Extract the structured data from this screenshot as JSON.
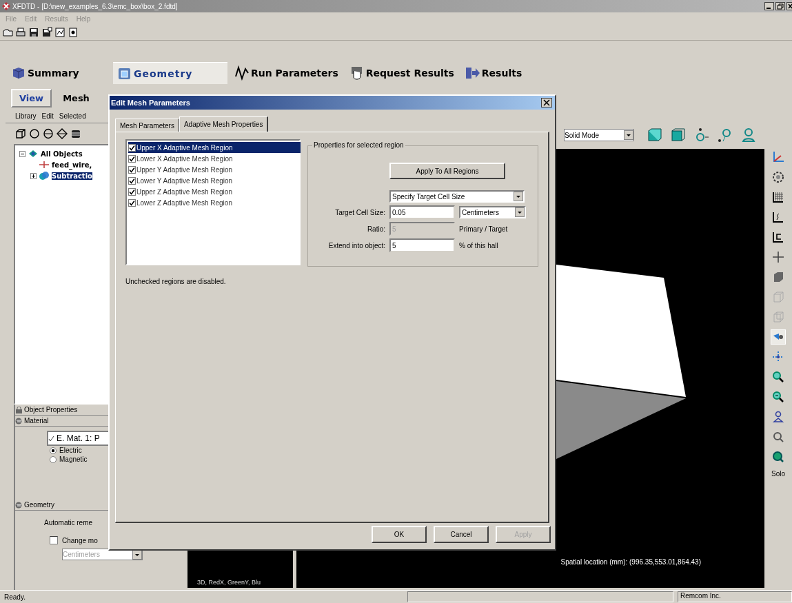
{
  "window": {
    "title": "XFDTD - [D:\\new_examples_6.3\\emc_box\\box_2.fdtd]"
  },
  "menu": [
    {
      "label": "File",
      "disabled": true
    },
    {
      "label": "Edit",
      "disabled": true
    },
    {
      "label": "Results",
      "disabled": true
    },
    {
      "label": "Help",
      "disabled": true
    }
  ],
  "main_tabs": [
    {
      "label": "Summary",
      "selected": false
    },
    {
      "label": "Geometry",
      "selected": true
    },
    {
      "label": "Run Parameters",
      "selected": false
    },
    {
      "label": "Request Results",
      "selected": false
    },
    {
      "label": "Results",
      "selected": false
    }
  ],
  "sub_tabs": [
    {
      "label": "View",
      "selected": true
    },
    {
      "label": "Mesh",
      "selected": false
    }
  ],
  "left_panel": {
    "menu": [
      "Library",
      "Edit",
      "Selected"
    ],
    "tree": [
      {
        "label": "All Objects",
        "selected": false,
        "expanded": true,
        "children": [
          {
            "label": "feed_wire,",
            "selected": false
          },
          {
            "label": "Subtractio",
            "selected": true,
            "expanded": false
          }
        ]
      }
    ],
    "object_properties": {
      "title": "Object Properties"
    },
    "material": {
      "title": "Material",
      "select": {
        "value": "E. Mat. 1: P",
        "checked": true
      },
      "radios": [
        {
          "label": "Electric",
          "selected": true
        },
        {
          "label": "Magnetic",
          "selected": false
        }
      ]
    },
    "geometry": {
      "title": "Geometry",
      "text": "Automatic reme",
      "checkbox": {
        "label": "Change mo",
        "checked": false
      },
      "units": {
        "value": "Centimeters",
        "disabled": true
      }
    }
  },
  "viewport": {
    "mode": "Solid Mode",
    "axes_label": "3D, RedX, GreenY, Blu",
    "location": "Spatial location (mm): (996.35,553.01,864.43)",
    "side_label": "Solo"
  },
  "dialog": {
    "title": "Edit Mesh Parameters",
    "tabs": [
      {
        "label": "Mesh Parameters",
        "selected": false
      },
      {
        "label": "Adaptive Mesh Properties",
        "selected": true
      }
    ],
    "regions": [
      {
        "label": "Upper X Adaptive Mesh Region",
        "checked": true,
        "selected": true
      },
      {
        "label": "Lower X Adaptive Mesh Region",
        "checked": true,
        "selected": false
      },
      {
        "label": "Upper Y Adaptive Mesh Region",
        "checked": true,
        "selected": false
      },
      {
        "label": "Lower Y Adaptive Mesh Region",
        "checked": true,
        "selected": false
      },
      {
        "label": "Upper Z Adaptive Mesh Region",
        "checked": true,
        "selected": false
      },
      {
        "label": "Lower Z Adaptive Mesh Region",
        "checked": true,
        "selected": false
      }
    ],
    "group": {
      "title": "Properties for selected region",
      "apply_button": "Apply To All Regions",
      "mode": "Specify Target Cell Size",
      "fields": [
        {
          "label": "Target Cell Size:",
          "value": "0.05",
          "disabled": false,
          "unit": {
            "kind": "select",
            "text": "Centimeters"
          }
        },
        {
          "label": "Ratio:",
          "value": "5",
          "disabled": true,
          "unit": {
            "kind": "text",
            "text": "Primary / Target"
          }
        },
        {
          "label": "Extend into object:",
          "value": "5",
          "disabled": false,
          "unit": {
            "kind": "text",
            "text": "% of this hall"
          }
        }
      ]
    },
    "note": "Unchecked regions are disabled.",
    "buttons": [
      {
        "label": "OK",
        "disabled": false
      },
      {
        "label": "Cancel",
        "disabled": false
      },
      {
        "label": "Apply",
        "disabled": true
      }
    ]
  },
  "status_bar": {
    "message": "Ready.",
    "company": "Remcom Inc."
  }
}
